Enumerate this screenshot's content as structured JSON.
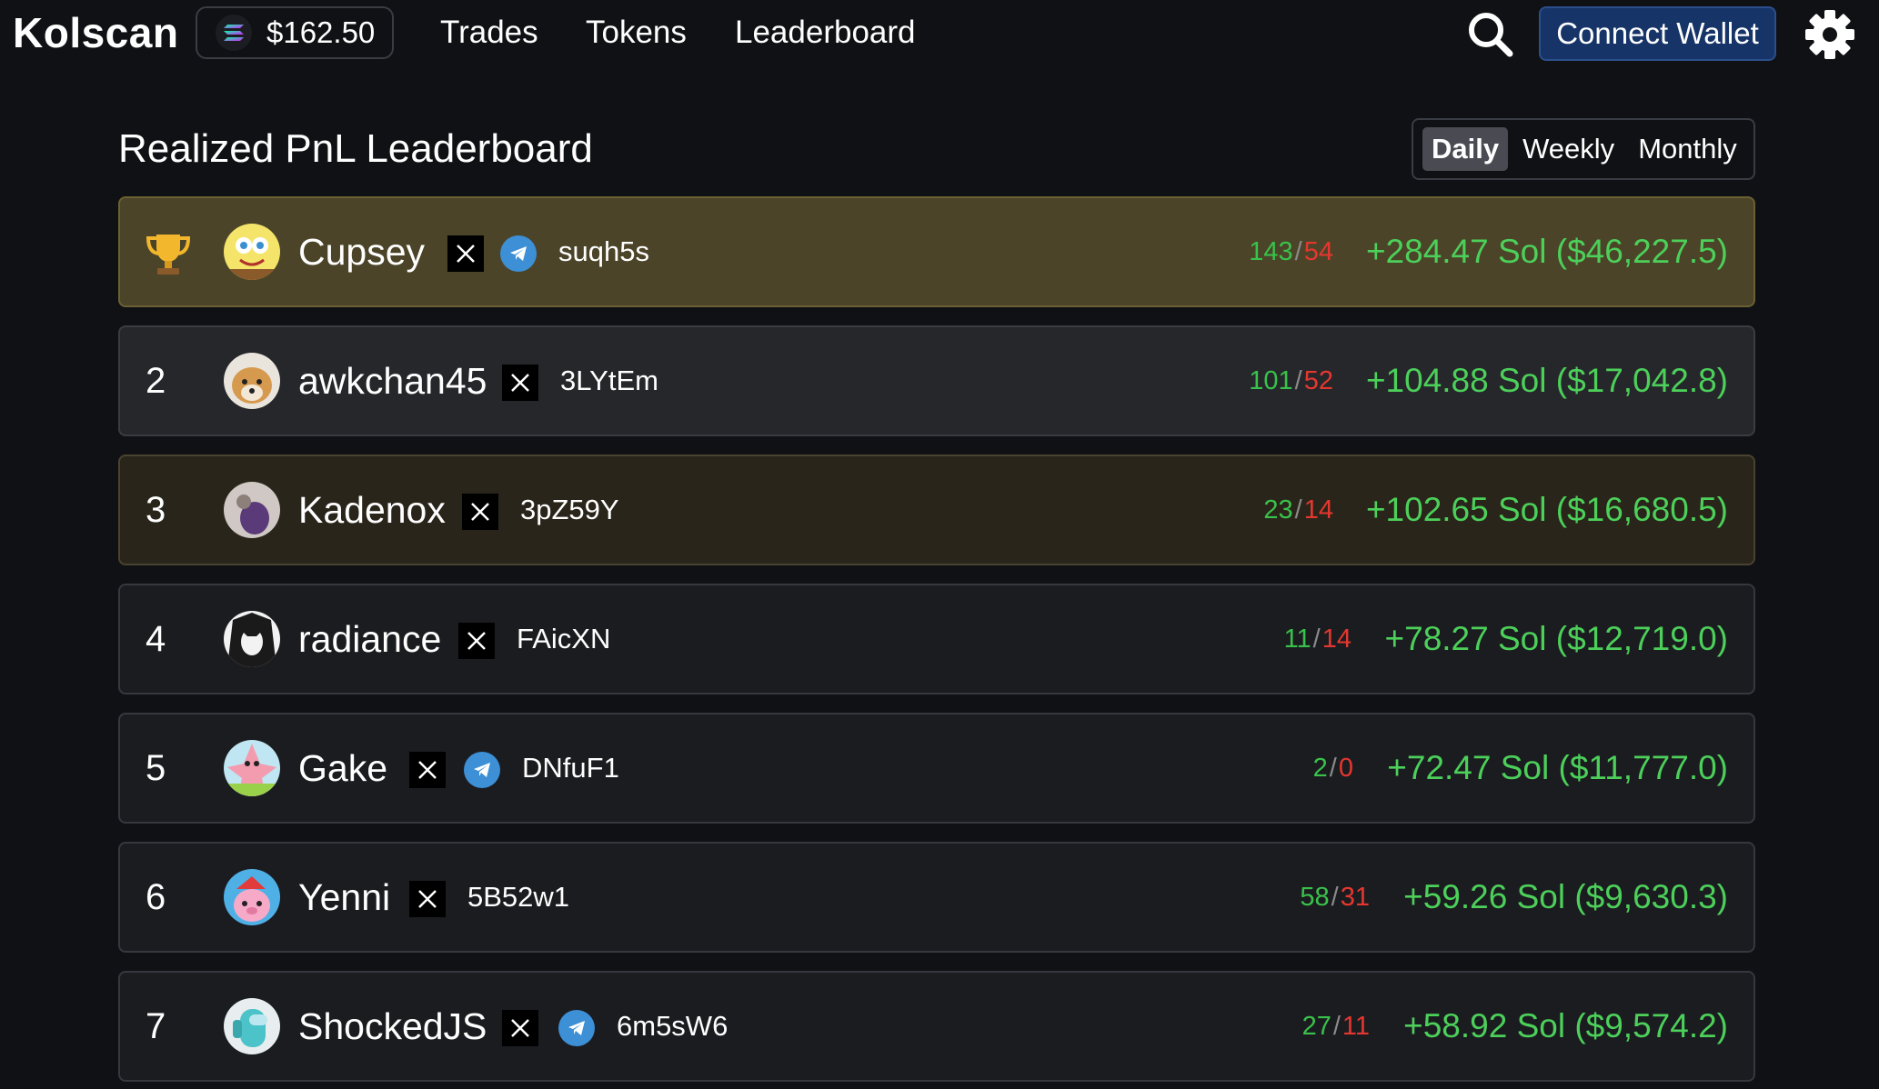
{
  "app": {
    "logo": "Kolscan",
    "sol_price": "$162.50",
    "nav": [
      "Trades",
      "Tokens",
      "Leaderboard"
    ],
    "connect_label": "Connect Wallet"
  },
  "page": {
    "title": "Realized PnL Leaderboard",
    "periods": [
      "Daily",
      "Weekly",
      "Monthly"
    ],
    "active_period": "Daily"
  },
  "colors": {
    "accent_green": "#4cd05a",
    "loss_red": "#e5372f",
    "first_place_bg": "#4b4428",
    "connect_button_bg": "#163467"
  },
  "leaderboard": [
    {
      "rank": "1",
      "rank_icon": "trophy-icon",
      "name": "Cupsey",
      "avatar": "spongebob-avatar",
      "has_x": true,
      "has_telegram": true,
      "wallet": "suqh5s",
      "wins": "143",
      "losses": "54",
      "pnl": "+284.47 Sol ($46,227.5)"
    },
    {
      "rank": "2",
      "name": "awkchan45",
      "avatar": "shiba-dog-avatar",
      "has_x": true,
      "has_telegram": false,
      "wallet": "3LYtEm",
      "wins": "101",
      "losses": "52",
      "pnl": "+104.88 Sol ($17,042.8)"
    },
    {
      "rank": "3",
      "name": "Kadenox",
      "avatar": "purple-character-avatar",
      "has_x": true,
      "has_telegram": false,
      "wallet": "3pZ59Y",
      "wins": "23",
      "losses": "14",
      "pnl": "+102.65 Sol ($16,680.5)"
    },
    {
      "rank": "4",
      "name": "radiance",
      "avatar": "anime-bw-avatar",
      "has_x": true,
      "has_telegram": false,
      "wallet": "FAicXN",
      "wins": "11",
      "losses": "14",
      "pnl": "+78.27 Sol ($12,719.0)"
    },
    {
      "rank": "5",
      "name": "Gake",
      "avatar": "patrick-star-avatar",
      "has_x": true,
      "has_telegram": true,
      "wallet": "DNfuF1",
      "wins": "2",
      "losses": "0",
      "pnl": "+72.47 Sol ($11,777.0)"
    },
    {
      "rank": "6",
      "name": "Yenni",
      "avatar": "pink-bear-avatar",
      "has_x": true,
      "has_telegram": false,
      "wallet": "5B52w1",
      "wins": "58",
      "losses": "31",
      "pnl": "+59.26 Sol ($9,630.3)"
    },
    {
      "rank": "7",
      "name": "ShockedJS",
      "avatar": "among-us-avatar",
      "has_x": true,
      "has_telegram": true,
      "wallet": "6m5sW6",
      "wins": "27",
      "losses": "11",
      "pnl": "+58.92 Sol ($9,574.2)"
    }
  ]
}
